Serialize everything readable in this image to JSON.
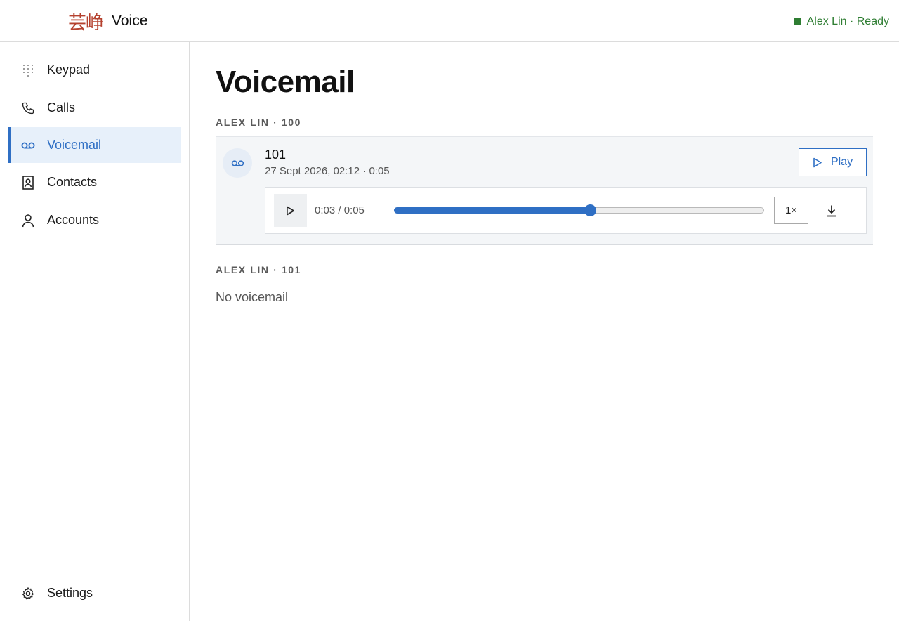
{
  "header": {
    "logo_mark": "芸峥",
    "app_name": "Voice",
    "status_text": "Alex Lin · Ready",
    "status_color": "#2e7d32"
  },
  "sidebar": {
    "items": [
      {
        "label": "Keypad",
        "icon": "keypad-icon"
      },
      {
        "label": "Calls",
        "icon": "phone-icon"
      },
      {
        "label": "Voicemail",
        "icon": "voicemail-icon",
        "active": true
      },
      {
        "label": "Contacts",
        "icon": "contact-book-icon"
      },
      {
        "label": "Accounts",
        "icon": "person-icon"
      }
    ],
    "settings_label": "Settings"
  },
  "main": {
    "title": "Voicemail",
    "sections": [
      {
        "label": "ALEX LIN · 100",
        "voicemails": [
          {
            "number": "101",
            "meta": "27 Sept 2026, 02:12 · 0:05",
            "play_label": "Play",
            "player": {
              "time": "0:03 / 0:05",
              "progress": 0.53,
              "speed": "1×"
            }
          }
        ]
      },
      {
        "label": "ALEX LIN · 101",
        "empty_text": "No voicemail"
      }
    ]
  },
  "colors": {
    "accent": "#2f6fc4",
    "active_bg": "#e7f0fa",
    "logo": "#b5412e"
  }
}
